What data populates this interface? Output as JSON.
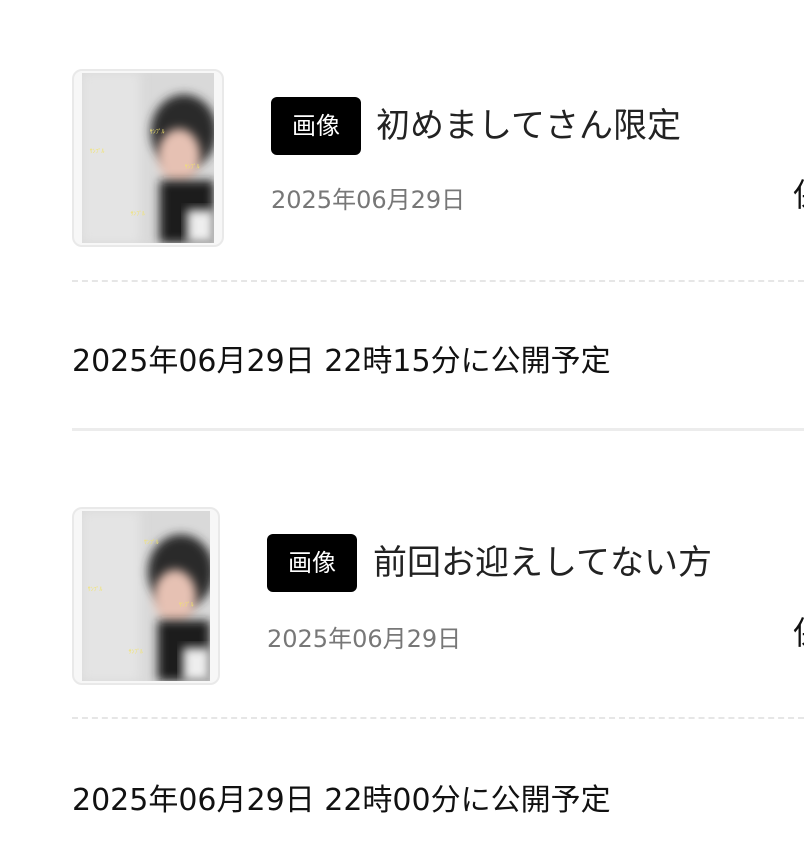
{
  "posts": [
    {
      "badge": "画像",
      "title": "初めましてさん限定",
      "date": "2025年06月29日",
      "edge_text": "保",
      "schedule": "2025年06月29日 22時15分に公開予定"
    },
    {
      "badge": "画像",
      "title": "前回お迎えしてない方",
      "date": "2025年06月29日",
      "edge_text": "保",
      "schedule": "2025年06月29日 22時00分に公開予定"
    }
  ],
  "colors": {
    "badge_bg": "#000000",
    "badge_text": "#ffffff",
    "date_text": "#777777",
    "divider": "#ececec"
  }
}
